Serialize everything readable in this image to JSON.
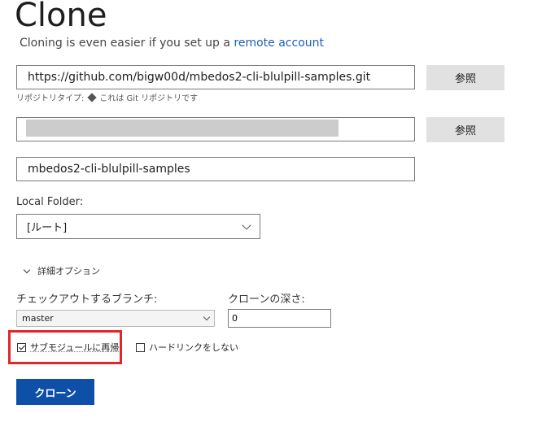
{
  "header": {
    "title": "Clone",
    "subtitle_prefix": "Cloning is even easier if you set up a",
    "subtitle_link": "remote account"
  },
  "repo_url": {
    "value": "https://github.com/bigw00d/mbedos2-cli-blulpill-samples.git",
    "browse_label": "参照"
  },
  "repo_type": {
    "label": "リポジトリタイプ:",
    "icon": "git-icon",
    "text": "これは Git リポジトリです"
  },
  "destination_path": {
    "value": "",
    "browse_label": "参照"
  },
  "repo_name": {
    "value": "mbedos2-cli-blulpill-samples"
  },
  "local_folder": {
    "label": "Local Folder:",
    "selected": "[ルート]"
  },
  "advanced": {
    "label": "詳細オプション"
  },
  "branch": {
    "label": "チェックアウトするブランチ:",
    "selected": "master"
  },
  "depth": {
    "label": "クローンの深さ:",
    "value": "0"
  },
  "options": {
    "recurse_submodules": {
      "label": "サブモジュールに再帰",
      "checked": true
    },
    "no_hardlinks": {
      "label": "ハードリンクをしない",
      "checked": false
    }
  },
  "clone_button": {
    "label": "クローン"
  },
  "colors": {
    "accent": "#0e4fa8",
    "highlight": "#e0282a",
    "link": "#1a5fb4"
  }
}
